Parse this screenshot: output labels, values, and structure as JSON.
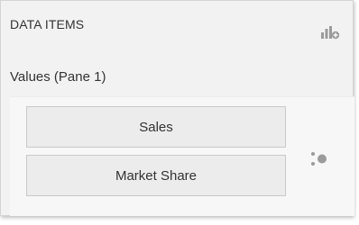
{
  "panel": {
    "title": "DATA ITEMS",
    "add_icon": "add-data-item-icon"
  },
  "section": {
    "label": "Values (Pane 1)"
  },
  "items": [
    {
      "label": "Sales"
    },
    {
      "label": "Market Share"
    }
  ],
  "options_icon": "series-options-icon",
  "colors": {
    "panel_bg": "#f2f2f2",
    "item_bg": "#ececec",
    "item_border": "#c9c9c9",
    "icon_gray": "#9b9b9b"
  }
}
